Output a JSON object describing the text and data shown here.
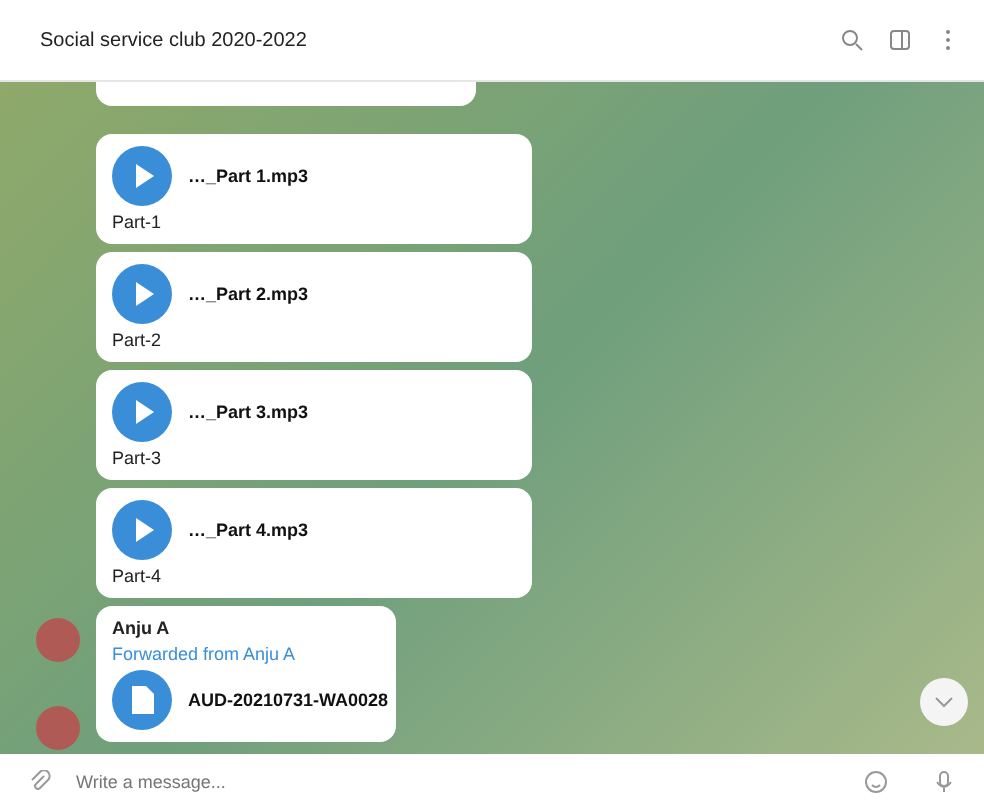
{
  "window": {
    "title": "Social service club 2020-2022"
  },
  "messages": [
    {
      "kind": "audio",
      "file": "…_Part 1.mp3",
      "caption": "Part-1"
    },
    {
      "kind": "audio",
      "file": "…_Part 2.mp3",
      "caption": "Part-2"
    },
    {
      "kind": "audio",
      "file": "…_Part 3.mp3",
      "caption": "Part-3"
    },
    {
      "kind": "audio",
      "file": "…_Part 4.mp3",
      "caption": "Part-4"
    },
    {
      "kind": "forward",
      "sender": "Anju A",
      "forwarded": "Forwarded from Anju A",
      "file": "AUD-20210731-WA0028"
    }
  ],
  "composer": {
    "placeholder": "Write a message..."
  }
}
